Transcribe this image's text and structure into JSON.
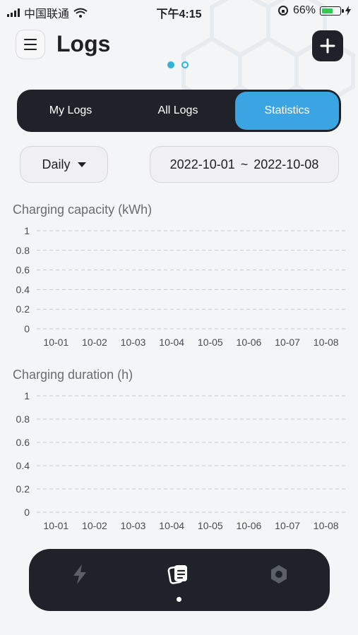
{
  "status_bar": {
    "carrier": "中国联通",
    "time": "下午4:15",
    "battery_pct": "66%",
    "battery_level": 0.66,
    "icons": [
      "signal-icon",
      "wifi-icon",
      "rotation-lock-icon",
      "battery-icon",
      "charging-icon"
    ]
  },
  "header": {
    "title": "Logs",
    "menu_icon": "hamburger-menu-icon",
    "add_icon": "plus-icon",
    "page_indicator": {
      "count": 2,
      "active": 0
    }
  },
  "tabs": {
    "items": [
      "My Logs",
      "All Logs",
      "Statistics"
    ],
    "active": "Statistics"
  },
  "filters": {
    "period": "Daily",
    "date_range": {
      "start": "2022-10-01",
      "separator": "~",
      "end": "2022-10-08"
    }
  },
  "colors": {
    "accent": "#3aa5e2",
    "dark_surface": "#1f2329",
    "page_dot": "#2fb3d8",
    "battery_fill": "#35c759"
  },
  "chart_data": [
    {
      "type": "bar",
      "title": "Charging capacity (kWh)",
      "categories": [
        "10-01",
        "10-02",
        "10-03",
        "10-04",
        "10-05",
        "10-06",
        "10-07",
        "10-08"
      ],
      "values": [
        0,
        0,
        0,
        0,
        0,
        0,
        0,
        0
      ],
      "y_ticks": [
        "0",
        "0.2",
        "0.4",
        "0.6",
        "0.8",
        "1"
      ],
      "ylim": [
        0,
        1
      ],
      "grid": true
    },
    {
      "type": "bar",
      "title": "Charging duration (h)",
      "categories": [
        "10-01",
        "10-02",
        "10-03",
        "10-04",
        "10-05",
        "10-06",
        "10-07",
        "10-08"
      ],
      "values": [
        0,
        0,
        0,
        0,
        0,
        0,
        0,
        0
      ],
      "y_ticks": [
        "0",
        "0.2",
        "0.4",
        "0.6",
        "0.8",
        "1"
      ],
      "ylim": [
        0,
        1
      ],
      "grid": true
    }
  ],
  "bottom_nav": {
    "items": [
      {
        "icon": "lightning-bolt-icon",
        "active": false
      },
      {
        "icon": "logs-cards-icon",
        "active": true
      },
      {
        "icon": "hexagon-settings-icon",
        "active": false
      }
    ]
  }
}
